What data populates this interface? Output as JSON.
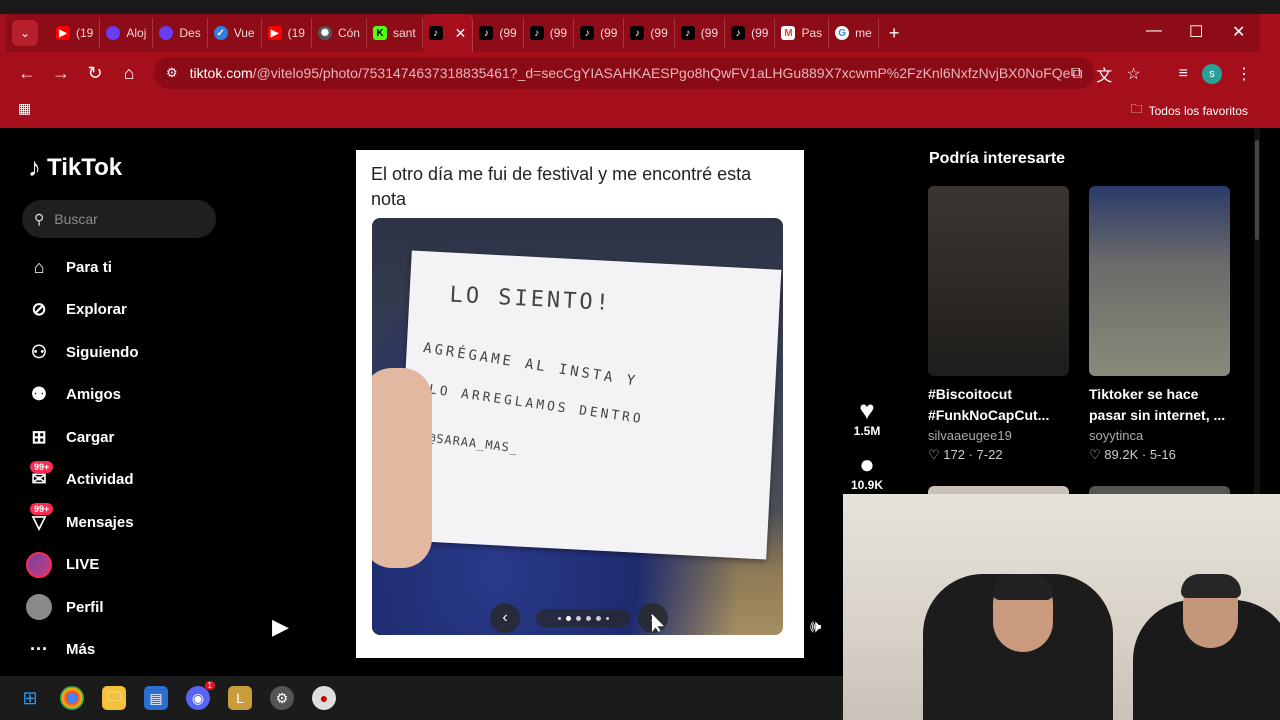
{
  "browser": {
    "tabs": [
      {
        "label": "(19",
        "icon": "youtube-icon",
        "color": "#ff0000"
      },
      {
        "label": "Aloj",
        "icon": "app-icon",
        "color": "#6a3df0"
      },
      {
        "label": "Des",
        "icon": "app-icon",
        "color": "#6a3df0"
      },
      {
        "label": "Vue",
        "icon": "check-icon",
        "color": "#2f7fe0"
      },
      {
        "label": "(19",
        "icon": "youtube-icon",
        "color": "#ff0000"
      },
      {
        "label": "Cón",
        "icon": "openai-icon",
        "color": "#555555"
      },
      {
        "label": "sant",
        "icon": "k-icon",
        "color": "#53fc18"
      },
      {
        "label": "",
        "icon": "tiktok-icon",
        "color": "#000000"
      },
      {
        "label": "(99",
        "icon": "tiktok-icon",
        "color": "#000000"
      },
      {
        "label": "(99",
        "icon": "tiktok-icon",
        "color": "#000000"
      },
      {
        "label": "(99",
        "icon": "tiktok-icon",
        "color": "#000000"
      },
      {
        "label": "(99",
        "icon": "tiktok-icon",
        "color": "#000000"
      },
      {
        "label": "(99",
        "icon": "tiktok-icon",
        "color": "#000000"
      },
      {
        "label": "(99",
        "icon": "tiktok-icon",
        "color": "#000000"
      },
      {
        "label": "Pas",
        "icon": "gmail-icon",
        "color": "#ea4335"
      },
      {
        "label": "me",
        "icon": "google-icon",
        "color": "#4285f4"
      }
    ],
    "url_host": "tiktok.com",
    "url_path": "/@vitelo95/photo/7531474637318835461?_d=secCgYIASAHKAESPgo8hQwFV1aLHGu889X7xcwmP%2FzKnl6NxfzNvjBX0NoFQeML%2BZ...",
    "bookmarks_label": "Todos los favoritos",
    "profile_initial": "s"
  },
  "tiktok": {
    "brand": "TikTok",
    "search_placeholder": "Buscar",
    "nav": [
      {
        "label": "Para ti",
        "icon": "home-icon"
      },
      {
        "label": "Explorar",
        "icon": "compass-icon"
      },
      {
        "label": "Siguiendo",
        "icon": "following-icon"
      },
      {
        "label": "Amigos",
        "icon": "friends-icon"
      },
      {
        "label": "Cargar",
        "icon": "upload-icon"
      },
      {
        "label": "Actividad",
        "icon": "inbox-icon",
        "badge": "99+"
      },
      {
        "label": "Mensajes",
        "icon": "message-icon",
        "badge": "99+"
      },
      {
        "label": "LIVE",
        "icon": "live-avatar"
      },
      {
        "label": "Perfil",
        "icon": "profile-avatar"
      },
      {
        "label": "Más",
        "icon": "more-icon"
      }
    ],
    "post": {
      "caption": "El otro día me fui de festival y me encontré esta nota",
      "note_lines": [
        "LO  SIENTO!",
        "AGRÉGAME  AL  INSTA  Y",
        "LO  ARREGLAMOS  DENTRO",
        "@SARAA_MAS_"
      ]
    },
    "actions": {
      "likes": "1.5M",
      "comments": "10.9K"
    },
    "recommendations_title": "Podría interesarte",
    "recommendations": [
      {
        "title": "#Biscoitocut #FunkNoCapCut...",
        "user": "silvaaeugee19",
        "likes": "172",
        "date": "7-22"
      },
      {
        "title": "Tiktoker se hace pasar sin internet, ...",
        "user": "soyytinca",
        "likes": "89.2K",
        "date": "5-16"
      }
    ]
  },
  "taskbar": {
    "discord_badge": "1"
  }
}
